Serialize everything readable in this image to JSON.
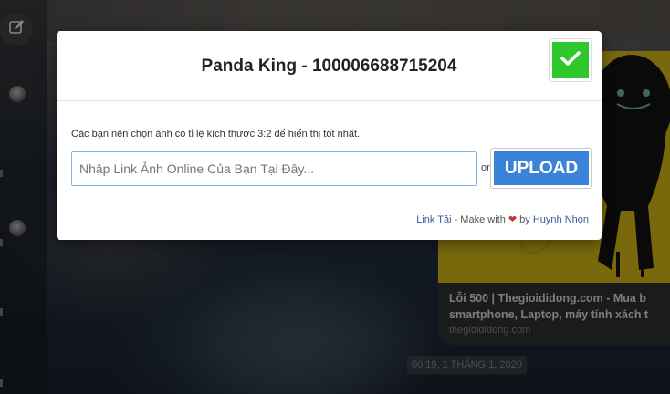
{
  "modal": {
    "title": "Panda King - 100006688715204",
    "hint": "Các bạn nên chọn ảnh có tỉ lệ kích thước 3:2 để hiển thị tốt nhất.",
    "input_placeholder": "Nhập Link Ảnh Online Của Bạn Tại Đây...",
    "or_label": "or",
    "upload_label": "UPLOAD",
    "confirm_icon": "checkmark-icon",
    "confirm_color": "#2ec82e",
    "upload_color": "#3a83d8",
    "footer": {
      "link_tai": "Link Tải",
      "made_with": " - Make with ",
      "heart_icon": "heart-icon",
      "by": " by ",
      "author": "Huynh Nhọn"
    }
  },
  "background": {
    "preview_title_line1": "Lỗi 500 | Thegioididong.com - Mua b",
    "preview_title_line2": "smartphone, Laptop, máy tính xách t",
    "preview_domain": "thegioididong.com",
    "timestamp": "00:19, 1 THÁNG 1, 2020"
  }
}
